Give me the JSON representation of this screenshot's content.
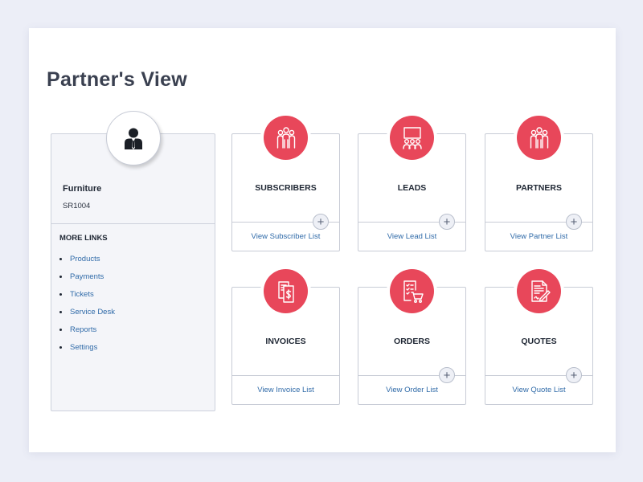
{
  "page": {
    "title": "Partner's View"
  },
  "profile": {
    "name": "Furniture",
    "id": "SR1004",
    "avatar_icon": "user-icon",
    "links_title": "MORE LINKS",
    "links": [
      "Products",
      "Payments",
      "Tickets",
      "Service Desk",
      "Reports",
      "Settings"
    ]
  },
  "cards": [
    {
      "title": "SUBSCRIBERS",
      "link": "View Subscriber List",
      "icon": "group-icon",
      "has_add": true
    },
    {
      "title": "LEADS",
      "link": "View Lead List",
      "icon": "presentation-icon",
      "has_add": true
    },
    {
      "title": "PARTNERS",
      "link": "View Partner List",
      "icon": "group-icon",
      "has_add": true
    },
    {
      "title": "INVOICES",
      "link": "View Invoice List",
      "icon": "invoice-icon",
      "has_add": false
    },
    {
      "title": "ORDERS",
      "link": "View Order List",
      "icon": "order-cart-icon",
      "has_add": true
    },
    {
      "title": "QUOTES",
      "link": "View Quote List",
      "icon": "quote-document-icon",
      "has_add": true
    }
  ],
  "colors": {
    "accent": "#e8475a",
    "link": "#2f6aa8",
    "background": "#eceef7"
  }
}
